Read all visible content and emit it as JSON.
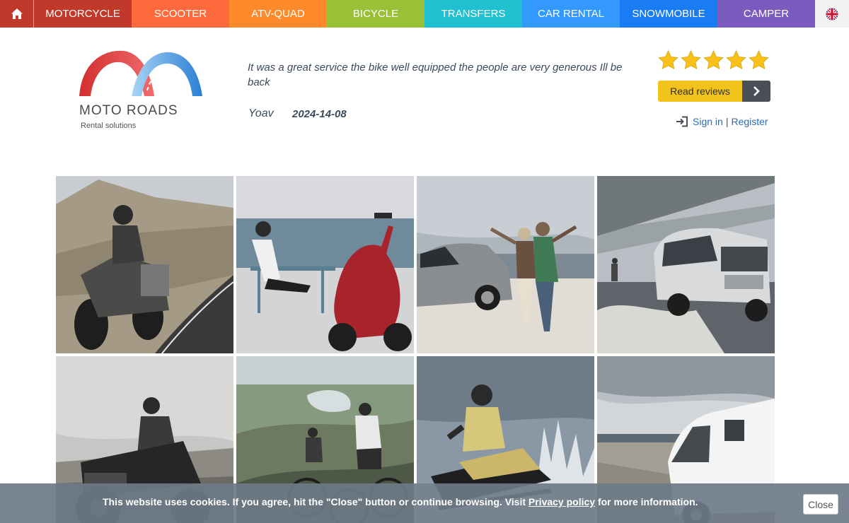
{
  "nav": {
    "items": [
      {
        "label": "MOTORCYCLE",
        "color": "#c0392b"
      },
      {
        "label": "SCOOTER",
        "color": "#ff6a3d"
      },
      {
        "label": "ATV-QUAD",
        "color": "#ff8a2b"
      },
      {
        "label": "BICYCLE",
        "color": "#9ac037"
      },
      {
        "label": "TRANSFERS",
        "color": "#1fc0cf"
      },
      {
        "label": "CAR RENTAL",
        "color": "#3399ff"
      },
      {
        "label": "SNOWMOBILE",
        "color": "#1a7cf5"
      },
      {
        "label": "CAMPER",
        "color": "#7c5bbf"
      }
    ],
    "home_icon": "home-icon",
    "flag_icon": "uk-flag-icon"
  },
  "logo": {
    "name": "MOTO ROADS",
    "tagline": "Rental solutions"
  },
  "review": {
    "text": "It was a great service the bike well equipped the people are very generous Ill be back",
    "author": "Yoav",
    "date": "2024-14-08",
    "rating": 5,
    "read_reviews_label": "Read reviews"
  },
  "auth": {
    "sign_in": "Sign in",
    "separator": "|",
    "register": "Register"
  },
  "gallery": {
    "tiles": [
      {
        "subject": "motorcycle"
      },
      {
        "subject": "scooter"
      },
      {
        "subject": "car"
      },
      {
        "subject": "van"
      },
      {
        "subject": "atv-quad"
      },
      {
        "subject": "bicycle"
      },
      {
        "subject": "snowmobile"
      },
      {
        "subject": "camper"
      }
    ]
  },
  "cookie": {
    "text_before": "This website uses cookies. If you agree, hit the \"Close\" button or continue browsing. Visit ",
    "link": "Privacy policy",
    "text_after": " for more information.",
    "close_label": "Close"
  },
  "colors": {
    "star": "#f7c21b",
    "link": "#2b6cb0",
    "button": "#f2c31b"
  }
}
